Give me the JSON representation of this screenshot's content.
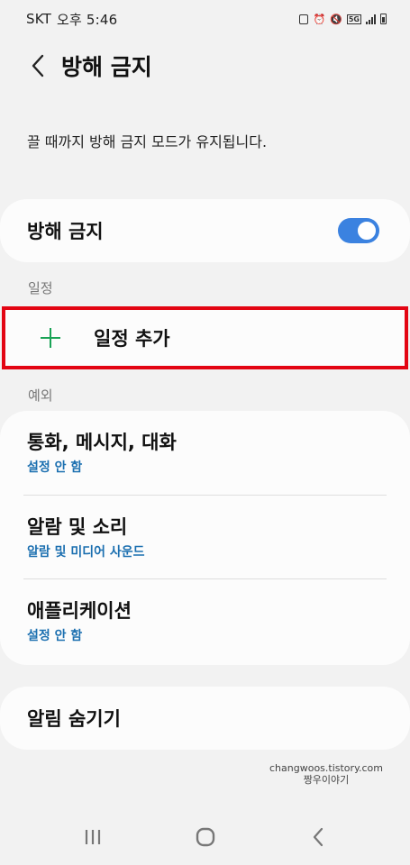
{
  "status_bar": {
    "carrier": "SKT",
    "time": "오후 5:46",
    "network": "5G"
  },
  "header": {
    "title": "방해 금지"
  },
  "description": "끌 때까지 방해 금지 모드가 유지됩니다.",
  "dnd": {
    "label": "방해 금지",
    "enabled": true
  },
  "schedule": {
    "section_label": "일정",
    "add_label": "일정 추가"
  },
  "exceptions": {
    "section_label": "예외",
    "items": [
      {
        "title": "통화, 메시지, 대화",
        "subtitle": "설정 안 함"
      },
      {
        "title": "알람 및 소리",
        "subtitle": "알람 및 미디어 사운드"
      },
      {
        "title": "애플리케이션",
        "subtitle": "설정 안 함"
      }
    ]
  },
  "hide_notifications": {
    "label": "알림 숨기기"
  },
  "watermark": {
    "line1": "changwoos.tistory.com",
    "line2": "짱우이야기"
  },
  "colors": {
    "accent_toggle": "#3b82e0",
    "highlight_border": "#e30513",
    "plus_icon": "#1aa356",
    "subtitle_link": "#1b6fb0"
  }
}
